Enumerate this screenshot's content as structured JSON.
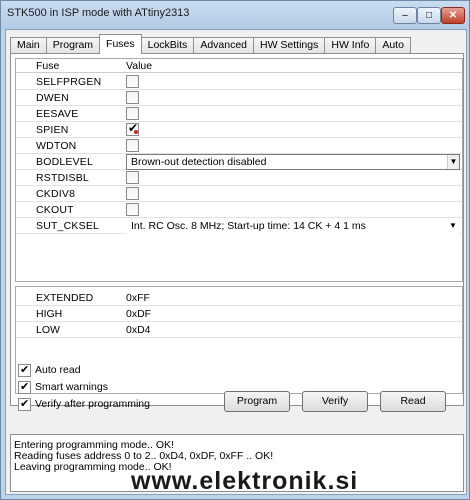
{
  "window": {
    "title": "STK500 in ISP mode with ATtiny2313",
    "minimize_icon": "minimize-icon",
    "maximize_icon": "maximize-icon",
    "close_icon": "close-icon"
  },
  "tabs": [
    {
      "label": "Main",
      "active": false
    },
    {
      "label": "Program",
      "active": false
    },
    {
      "label": "Fuses",
      "active": true
    },
    {
      "label": "LockBits",
      "active": false
    },
    {
      "label": "Advanced",
      "active": false
    },
    {
      "label": "HW Settings",
      "active": false
    },
    {
      "label": "HW Info",
      "active": false
    },
    {
      "label": "Auto",
      "active": false
    }
  ],
  "fuse_grid": {
    "col_fuse": "Fuse",
    "col_value": "Value",
    "rows": [
      {
        "name": "SELFPRGEN",
        "type": "checkbox",
        "checked": false
      },
      {
        "name": "DWEN",
        "type": "checkbox",
        "checked": false
      },
      {
        "name": "EESAVE",
        "type": "checkbox",
        "checked": false
      },
      {
        "name": "SPIEN",
        "type": "checkbox",
        "checked": true
      },
      {
        "name": "WDTON",
        "type": "checkbox",
        "checked": false
      },
      {
        "name": "BODLEVEL",
        "type": "dropdown",
        "value": "Brown-out detection disabled"
      },
      {
        "name": "RSTDISBL",
        "type": "checkbox",
        "checked": false
      },
      {
        "name": "CKDIV8",
        "type": "checkbox",
        "checked": false
      },
      {
        "name": "CKOUT",
        "type": "checkbox",
        "checked": false
      },
      {
        "name": "SUT_CKSEL",
        "type": "dropdown",
        "value": "Int. RC Osc. 8 MHz; Start-up time: 14 CK + 4 1 ms"
      }
    ]
  },
  "fuse_summary": [
    {
      "name": "EXTENDED",
      "value": "0xFF"
    },
    {
      "name": "HIGH",
      "value": "0xDF"
    },
    {
      "name": "LOW",
      "value": "0xD4"
    }
  ],
  "options": [
    {
      "label": "Auto read",
      "checked": true
    },
    {
      "label": "Smart warnings",
      "checked": true
    },
    {
      "label": "Verify after programming",
      "checked": true
    }
  ],
  "buttons": {
    "program": "Program",
    "verify": "Verify",
    "read": "Read"
  },
  "log": [
    "Entering programming mode.. OK!",
    "Reading fuses address 0 to 2.. 0xD4, 0xDF, 0xFF .. OK!",
    "Leaving programming mode.. OK!"
  ],
  "watermark": "www.elektronik.si"
}
